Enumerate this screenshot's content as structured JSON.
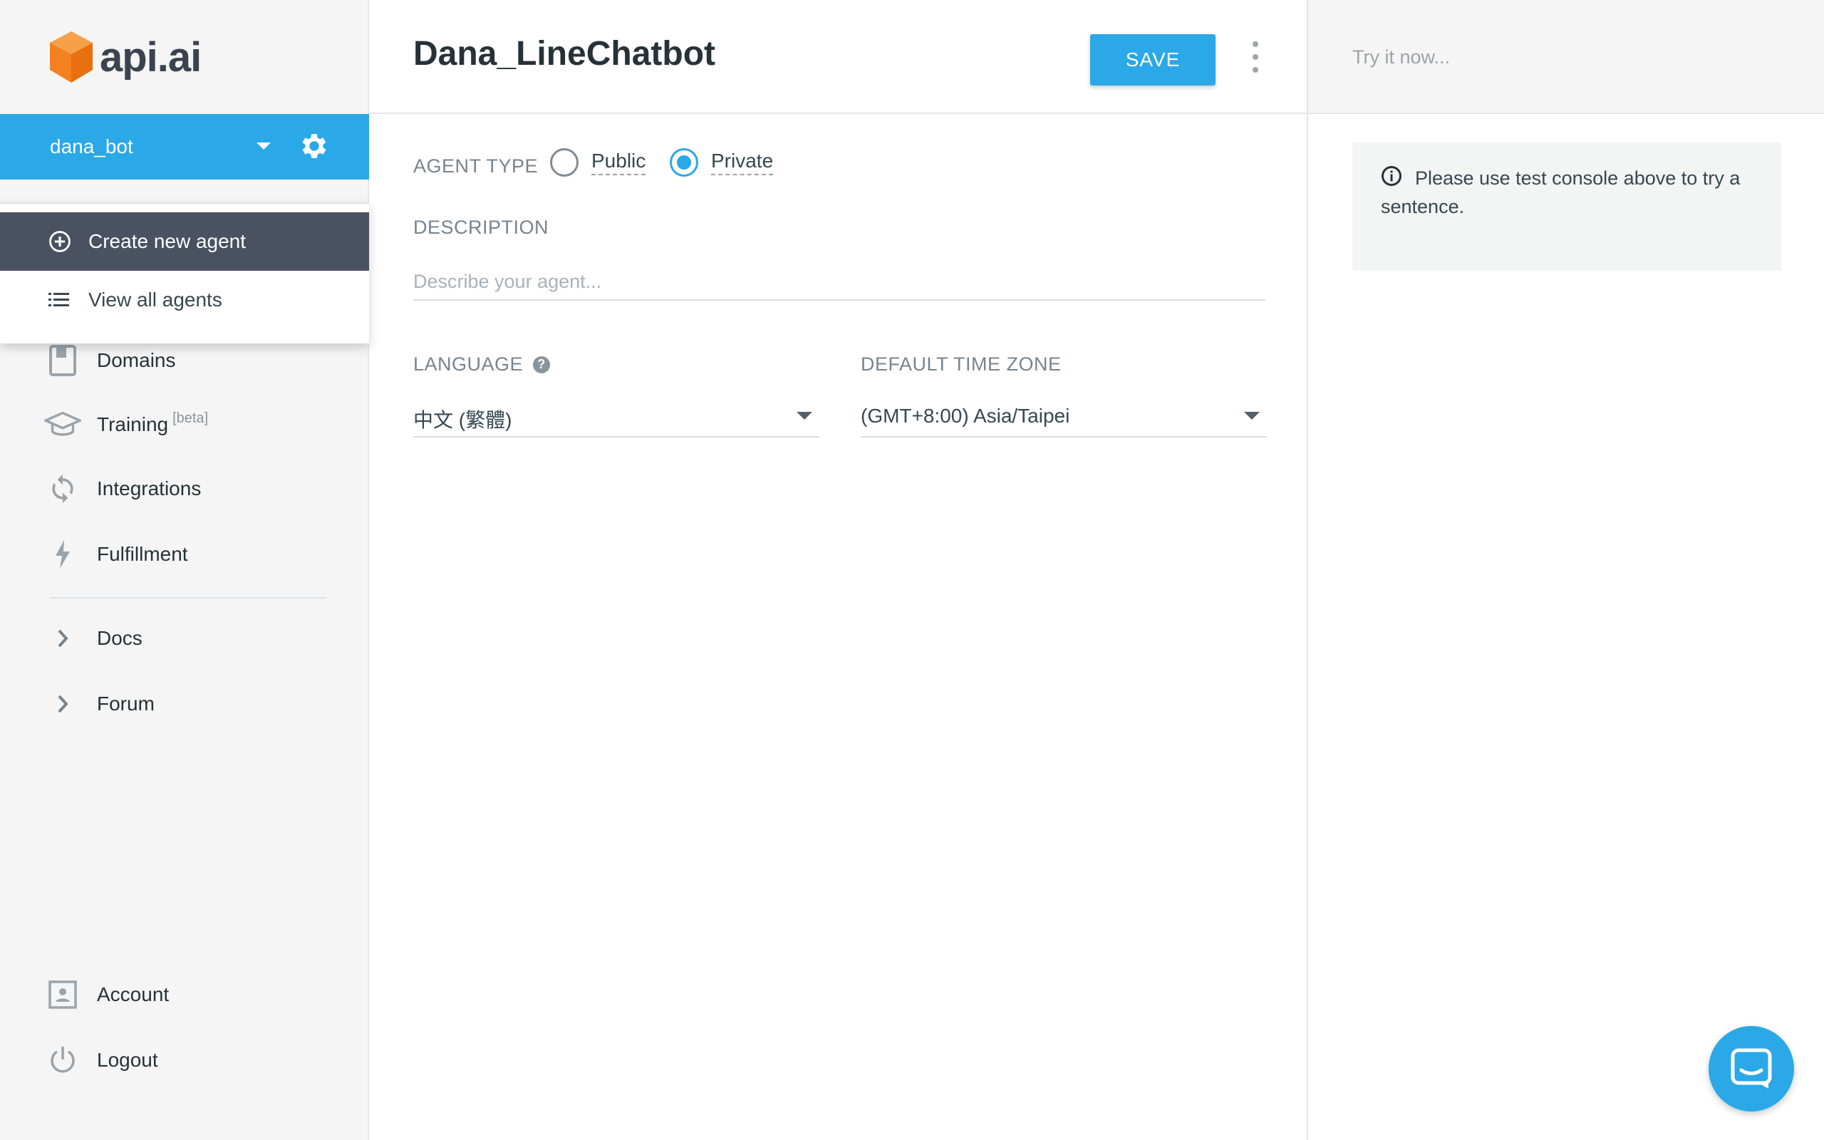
{
  "brand": {
    "logo_text": "api.ai"
  },
  "sidebar": {
    "agent_name": "dana_bot",
    "agent_menu": {
      "create_label": "Create new agent",
      "view_all_label": "View all agents"
    },
    "items": [
      {
        "label": "Domains",
        "icon": "book-icon"
      },
      {
        "label": "Training",
        "icon": "graduation-cap-icon",
        "badge": "[beta]"
      },
      {
        "label": "Integrations",
        "icon": "sync-icon"
      },
      {
        "label": "Fulfillment",
        "icon": "lightning-icon"
      }
    ],
    "links": [
      {
        "label": "Docs",
        "icon": "chevron-right-icon"
      },
      {
        "label": "Forum",
        "icon": "chevron-right-icon"
      }
    ],
    "footer": [
      {
        "label": "Account",
        "icon": "account-box-icon"
      },
      {
        "label": "Logout",
        "icon": "power-icon"
      }
    ]
  },
  "header": {
    "title": "Dana_LineChatbot",
    "save_label": "SAVE"
  },
  "form": {
    "agent_type_label": "AGENT TYPE",
    "agent_type_options": [
      "Public",
      "Private"
    ],
    "agent_type_selected": "Private",
    "description_label": "DESCRIPTION",
    "description_placeholder": "Describe your agent...",
    "description_value": "",
    "language_label": "LANGUAGE",
    "language_value": "中文 (繁體)",
    "timezone_label": "DEFAULT TIME ZONE",
    "timezone_value": "(GMT+8:00) Asia/Taipei"
  },
  "test_console": {
    "placeholder": "Try it now...",
    "info_text": "Please use test console above to try a sentence."
  },
  "colors": {
    "accent": "#2aa8e8",
    "sidebar_bg": "#f5f5f5",
    "menu_highlight": "#4a5161",
    "logo_orange": "#f4811f"
  }
}
